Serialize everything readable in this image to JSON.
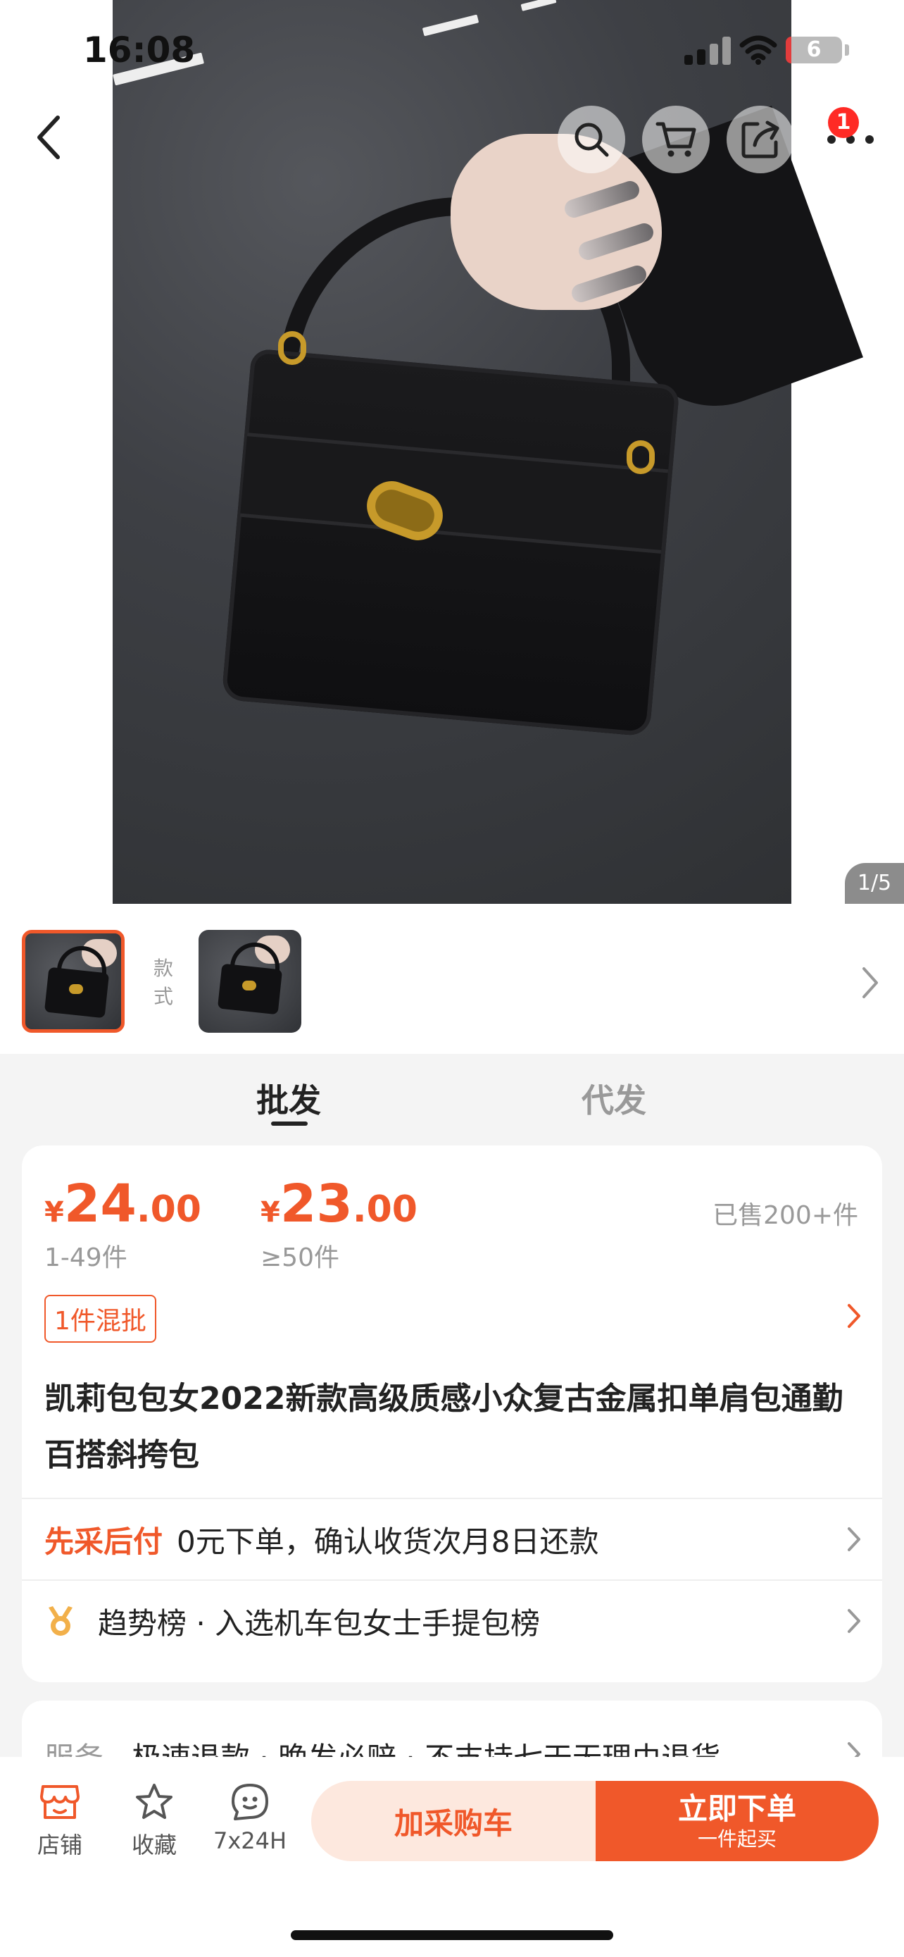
{
  "status_bar": {
    "time": "16:08",
    "battery_level": "6"
  },
  "nav": {
    "notification_count": "1"
  },
  "gallery": {
    "page_indicator": "1/5",
    "style_label": "款式"
  },
  "tabs": {
    "wholesale": "批发",
    "dropship": "代发"
  },
  "pricing": {
    "currency": "¥",
    "tiers": [
      {
        "int": "24",
        "dec": ".00",
        "qty": "1-49件"
      },
      {
        "int": "23",
        "dec": ".00",
        "qty": "≥50件"
      }
    ],
    "sold": "已售200+件",
    "mix_tag": "1件混批"
  },
  "product": {
    "title": "凯莉包包女2022新款高级质感小众复古金属扣单肩包通勤百搭斜挎包"
  },
  "pay_later": {
    "tag": "先采后付",
    "text": "0元下单，确认收货次月8日还款"
  },
  "ranking": {
    "text": "趋势榜 · 入选机车包女士手提包榜"
  },
  "service": {
    "label": "服务",
    "text": "极速退款 · 晚发必赔 · 不支持七天无理由退货"
  },
  "bottom_bar": {
    "shop": "店铺",
    "favorite": "收藏",
    "service_hours": "7x24H",
    "add_to_cart": "加采购车",
    "buy_now": "立即下单",
    "buy_now_sub": "一件起买"
  },
  "colors": {
    "accent": "#f0582a",
    "accent_light": "#fde8de",
    "badge_red": "#ff2a25"
  }
}
